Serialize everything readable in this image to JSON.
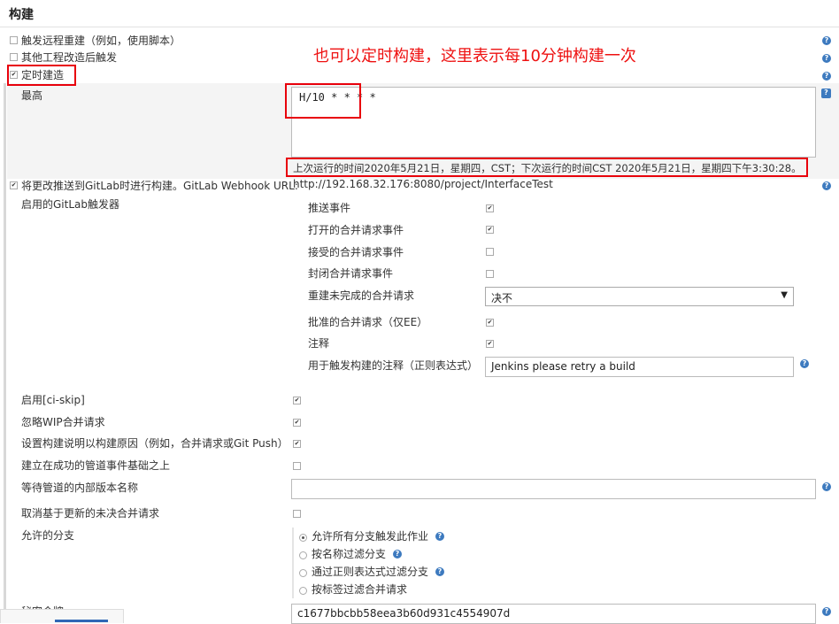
{
  "section": {
    "title": "构建"
  },
  "triggers": [
    {
      "label": "触发远程重建（例如，使用脚本）",
      "checked": false
    },
    {
      "label": "其他工程改造后触发",
      "checked": false
    },
    {
      "label": "定时建造",
      "checked": true
    }
  ],
  "schedule": {
    "field_label": "最高",
    "value": "H/10 * * * *",
    "status": "上次运行的时间2020年5月21日，星期四，CST；下次运行的时间CST 2020年5月21日，星期四下午3:30:28。"
  },
  "annotation": {
    "text": "也可以定时构建，这里表示每10分钟构建一次",
    "color": "#ee1111"
  },
  "gitlab": {
    "label": "将更改推送到GitLab时进行构建。GitLab Webhook URL:",
    "url": "http://192.168.32.176:8080/project/InterfaceTest",
    "checked": true,
    "enabled_triggers_label": "启用的GitLab触发器",
    "events": [
      {
        "label": "推送事件",
        "checked": true
      },
      {
        "label": "打开的合并请求事件",
        "checked": true
      },
      {
        "label": "接受的合并请求事件",
        "checked": false
      },
      {
        "label": "封闭合并请求事件",
        "checked": false
      }
    ],
    "rebuild": {
      "label": "重建未完成的合并请求",
      "selected": "决不"
    },
    "approved": {
      "label": "批准的合并请求（仅EE）",
      "checked": true
    },
    "comments": {
      "label": "注释",
      "checked": true
    },
    "comment_regex": {
      "label": "用于触发构建的注释（正则表达式）",
      "value": "Jenkins please retry a build"
    }
  },
  "options": [
    {
      "label": "启用[ci-skip]",
      "checked": true
    },
    {
      "label": "忽略WIP合并请求",
      "checked": true
    },
    {
      "label": "设置构建说明以构建原因（例如，合并请求或Git Push）",
      "checked": true
    },
    {
      "label": "建立在成功的管道事件基础之上",
      "checked": false
    }
  ],
  "pipeline_version": {
    "label": "等待管道的内部版本名称",
    "value": ""
  },
  "cancel_pending": {
    "label": "取消基于更新的未决合并请求",
    "checked": false
  },
  "branches": {
    "label": "允许的分支",
    "options": [
      {
        "label": "允许所有分支触发此作业",
        "selected": true
      },
      {
        "label": "按名称过滤分支",
        "selected": false
      },
      {
        "label": "通过正则表达式过滤分支",
        "selected": false
      },
      {
        "label": "按标签过滤合并请求",
        "selected": false
      }
    ]
  },
  "secret": {
    "label": "秘密令牌",
    "value": "c1677bbcbb58eea3b60d931c4554907d"
  },
  "icons": {
    "help": "help-icon",
    "checkbox": "checkmark-icon",
    "caret": "caret-down-icon"
  },
  "colors": {
    "help": "#3d7abf",
    "highlight": "#e8000b"
  }
}
